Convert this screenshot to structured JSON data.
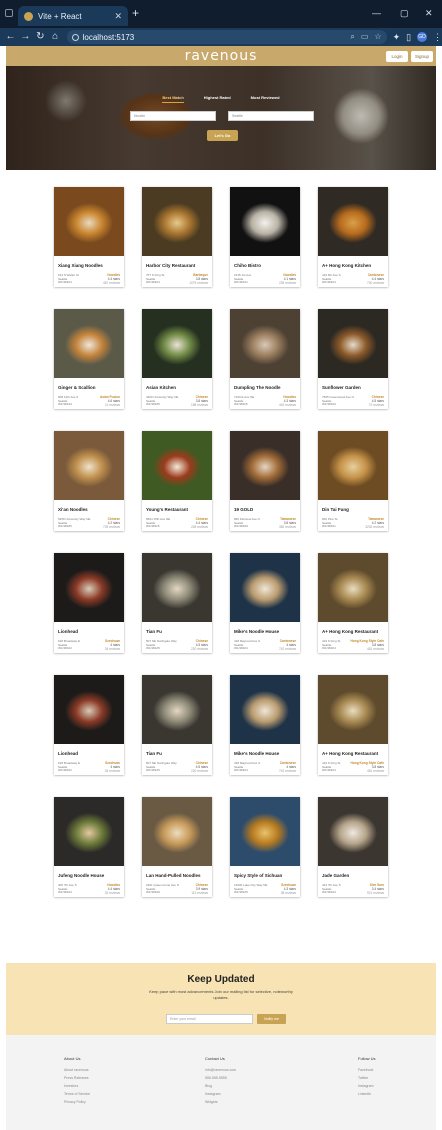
{
  "browser": {
    "tab_title": "Vite + React",
    "tab_close": "✕",
    "new_tab": "+",
    "url": "localhost:5173",
    "profile": "GD",
    "minimize": "—",
    "maximize": "▢",
    "close": "✕",
    "icons": [
      "back-arrow-icon",
      "forward-arrow-icon",
      "reload-icon",
      "home-icon",
      "site-info-icon",
      "search-lens-icon",
      "cast-icon",
      "bookmark-star-icon",
      "extensions-icon",
      "sidebar-icon"
    ]
  },
  "header": {
    "logo": "ravenous",
    "login": "Login",
    "signup": "Signup",
    "accent_color": "#c9a96b"
  },
  "hero": {
    "sort_tabs": [
      "Best Match",
      "Highest Rated",
      "Most Reviewed"
    ],
    "active_tab": "Best Match",
    "search_placeholder": "Noodle",
    "location_placeholder": "Seattle",
    "button": "Let's Go"
  },
  "businesses": [
    {
      "name": "Xiang Xiang Noodles",
      "address": "613 S Weller St",
      "city": "Seattle",
      "state": "WA 98104",
      "category": "Noodles",
      "rating": "4.4 stars",
      "reviews": "487 reviews",
      "img": [
        "#e8d9c0",
        "#c9852e",
        "#7a4a1e"
      ]
    },
    {
      "name": "Harbor City Restaurant",
      "address": "707 S King St",
      "city": "Seattle",
      "state": "WA 98104",
      "category": "Barbeque",
      "rating": "3.8 stars",
      "reviews": "1079 reviews",
      "img": [
        "#e7c98a",
        "#a8742f",
        "#4a3b22"
      ]
    },
    {
      "name": "Chiho Bistro",
      "address": "2135 1st Ave",
      "city": "Seattle",
      "state": "WA 98121",
      "category": "Noodles",
      "rating": "4.1 stars",
      "reviews": "235 reviews",
      "img": [
        "#f3f1ec",
        "#b9b3a6",
        "#111111"
      ]
    },
    {
      "name": "A+ Hong Kong Kitchen",
      "address": "419 6th Ave S",
      "city": "Seattle",
      "state": "WA 98104",
      "category": "Cantonese",
      "rating": "4.4 stars",
      "reviews": "700 reviews",
      "img": [
        "#d9a04a",
        "#b76b1d",
        "#2f2a24"
      ]
    },
    {
      "name": "Ginger & Scallion",
      "address": "608 12th Ave S",
      "city": "Seattle",
      "state": "WA 98144",
      "category": "Asian Fusion",
      "rating": "4.6 stars",
      "reviews": "11 reviews",
      "img": [
        "#efe6d9",
        "#c4833b",
        "#5b5a49"
      ]
    },
    {
      "name": "Asian Kitchen",
      "address": "4400 University Way NE",
      "city": "Seattle",
      "state": "WA 98105",
      "category": "Chinese",
      "rating": "3.8 stars",
      "reviews": "188 reviews",
      "img": [
        "#e9e3d2",
        "#6f8a45",
        "#263020"
      ]
    },
    {
      "name": "Dumpling The Noodle",
      "address": "7100 E Ave NE",
      "city": "Seattle",
      "state": "WA 98115",
      "category": "Noodles",
      "rating": "4.3 stars",
      "reviews": "443 reviews",
      "img": [
        "#d9c9b6",
        "#9a7d5e",
        "#4d4134"
      ]
    },
    {
      "name": "Sunflower Garden",
      "address": "7505 Greenwood Ave N",
      "city": "Seattle",
      "state": "WA 98103",
      "category": "Chinese",
      "rating": "4.5 stars",
      "reviews": "72 reviews",
      "img": [
        "#e6dbc8",
        "#8c5a2a",
        "#2c2822"
      ]
    },
    {
      "name": "Xi'an Noodles",
      "address": "5259 University Way NE",
      "city": "Seattle",
      "state": "WA 98105",
      "category": "Chinese",
      "rating": "4.2 stars",
      "reviews": "725 reviews",
      "img": [
        "#efe2c8",
        "#c0904e",
        "#7a5a3a"
      ]
    },
    {
      "name": "Young's Restaurant",
      "address": "6604 15th Ave NE",
      "city": "Seattle",
      "state": "WA 98115",
      "category": "Chinese",
      "rating": "4.4 stars",
      "reviews": "245 reviews",
      "img": [
        "#f2e9d8",
        "#9c3b1c",
        "#3f5a23"
      ]
    },
    {
      "name": "19 GOLD",
      "address": "960 Fairview Ave N",
      "city": "Seattle",
      "state": "WA 98109",
      "category": "Taiwanese",
      "rating": "3.8 stars",
      "reviews": "382 reviews",
      "img": [
        "#e4d6c3",
        "#a26b38",
        "#3a2f28"
      ]
    },
    {
      "name": "Din Tai Fung",
      "address": "600 Pine St",
      "city": "Seattle",
      "state": "WA 98101",
      "category": "Taiwanese",
      "rating": "4.2 stars",
      "reviews": "3230 reviews",
      "img": [
        "#e7cf9d",
        "#c59248",
        "#6e4c23"
      ]
    },
    {
      "name": "Lionhead",
      "address": "618 Broadway E",
      "city": "Seattle",
      "state": "WA 98102",
      "category": "Szechuan",
      "rating": "4 stars",
      "reviews": "34 reviews",
      "img": [
        "#d8ccb8",
        "#8b3a26",
        "#1c1b1a"
      ]
    },
    {
      "name": "Tian Fu",
      "address": "507 NE Northgate Way",
      "city": "Seattle",
      "state": "WA 98125",
      "category": "Chinese",
      "rating": "4.5 stars",
      "reviews": "220 reviews",
      "img": [
        "#e3d7c2",
        "#8e8a78",
        "#3a3731"
      ]
    },
    {
      "name": "Mike's Noodle House",
      "address": "418 Maynard Ave S",
      "city": "Seattle",
      "state": "WA 98104",
      "category": "Cantonese",
      "rating": "4 stars",
      "reviews": "742 reviews",
      "img": [
        "#eee6d6",
        "#bb9c70",
        "#1f3348"
      ]
    },
    {
      "name": "A+ Hong Kong Restaurant",
      "address": "419 S King St",
      "city": "Seattle",
      "state": "WA 98104",
      "category": "Hong Kong Style Cafe",
      "rating": "3.8 stars",
      "reviews": "481 reviews",
      "img": [
        "#eadcc0",
        "#a88a52",
        "#5e4a2c"
      ]
    },
    {
      "name": "Lionhead",
      "address": "618 Broadway E",
      "city": "Seattle",
      "state": "WA 98102",
      "category": "Szechuan",
      "rating": "4 stars",
      "reviews": "34 reviews",
      "img": [
        "#d8ccb8",
        "#8b3a26",
        "#1c1b1a"
      ]
    },
    {
      "name": "Tian Fu",
      "address": "507 NE Northgate Way",
      "city": "Seattle",
      "state": "WA 98125",
      "category": "Chinese",
      "rating": "4.5 stars",
      "reviews": "220 reviews",
      "img": [
        "#e3d7c2",
        "#8e8a78",
        "#3a3731"
      ]
    },
    {
      "name": "Mike's Noodle House",
      "address": "418 Maynard Ave S",
      "city": "Seattle",
      "state": "WA 98104",
      "category": "Cantonese",
      "rating": "4 stars",
      "reviews": "742 reviews",
      "img": [
        "#eee6d6",
        "#bb9c70",
        "#1f3348"
      ]
    },
    {
      "name": "A+ Hong Kong Restaurant",
      "address": "419 S King St",
      "city": "Seattle",
      "state": "WA 98104",
      "category": "Hong Kong Style Cafe",
      "rating": "3.8 stars",
      "reviews": "481 reviews",
      "img": [
        "#eadcc0",
        "#a88a52",
        "#5e4a2c"
      ]
    },
    {
      "name": "Jufeng Noodle House",
      "address": "405 7th Ave S",
      "city": "Seattle",
      "state": "WA 98104",
      "category": "Noodles",
      "rating": "4.4 stars",
      "reviews": "32 reviews",
      "img": [
        "#e2c9a0",
        "#6d7b3a",
        "#2c2a28"
      ]
    },
    {
      "name": "Lan Hand-Pulled Noodles",
      "address": "2201 Queen Anne Ave N",
      "city": "Seattle",
      "state": "WA 98109",
      "category": "Chinese",
      "rating": "3.9 stars",
      "reviews": "113 reviews",
      "img": [
        "#eddcbc",
        "#c79a5a",
        "#6a5a44"
      ]
    },
    {
      "name": "Spicy Style of Sichuan",
      "address": "13000 Lake City Way NE",
      "city": "Seattle",
      "state": "WA 98125",
      "category": "Szechuan",
      "rating": "4.3 stars",
      "reviews": "38 reviews",
      "img": [
        "#e9c36a",
        "#b77a20",
        "#2d4c6b"
      ]
    },
    {
      "name": "Jade Garden",
      "address": "424 7th Ave S",
      "city": "Seattle",
      "state": "WA 98104",
      "category": "Dim Sum",
      "rating": "3.4 stars",
      "reviews": "921 reviews",
      "img": [
        "#efe9df",
        "#b5a48a",
        "#3c3630"
      ]
    }
  ],
  "newsletter": {
    "title": "Keep Updated",
    "text": "Keep pace with most advancements Join our mailing list for selective, noteworthy updates.",
    "placeholder": "Enter your email",
    "button": "Notify me",
    "bg_color": "#f8e3b4"
  },
  "footer": {
    "columns": [
      {
        "heading": "About Us",
        "links": [
          "About ravenous",
          "Press Releases",
          "Investors",
          "Terms of Service",
          "Privacy Policy"
        ]
      },
      {
        "heading": "Contact Us",
        "links": [
          "info@ravenous.com",
          "555-555-5555",
          "Blog",
          "Instagram",
          "Widgets"
        ]
      },
      {
        "heading": "Follow Us",
        "links": [
          "Facebook",
          "Twitter",
          "Instagram",
          "LinkedIn"
        ]
      }
    ]
  }
}
